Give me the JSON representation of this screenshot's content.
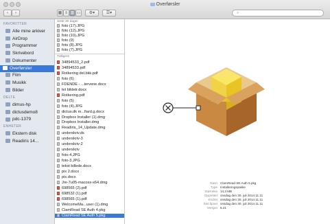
{
  "window": {
    "title": "Overførsler"
  },
  "toolbar": {
    "back": "‹",
    "forward": "›",
    "search_placeholder": ""
  },
  "sidebar": {
    "favorites_header": "FAVORITTER",
    "favorites": [
      {
        "label": "Alle mine arkiver",
        "icon": "all-files-icon"
      },
      {
        "label": "AirDrop",
        "icon": "airdrop-icon"
      },
      {
        "label": "Programmer",
        "icon": "applications-icon"
      },
      {
        "label": "Skrivebord",
        "icon": "desktop-icon"
      },
      {
        "label": "Dokumenter",
        "icon": "documents-icon"
      },
      {
        "label": "Overførsler",
        "icon": "downloads-icon"
      },
      {
        "label": "Film",
        "icon": "movies-icon"
      },
      {
        "label": "Musikk",
        "icon": "music-icon"
      },
      {
        "label": "Bilder",
        "icon": "pictures-icon"
      }
    ],
    "shared_header": "DELTE",
    "shared": [
      {
        "label": "dimus-hp",
        "icon": "network-pc-icon"
      },
      {
        "label": "dictusdemo8",
        "icon": "network-pc-icon"
      },
      {
        "label": "pdc-1379",
        "icon": "network-pc-icon"
      }
    ],
    "devices_header": "ENHETER",
    "devices": [
      {
        "label": "Ekstern disk",
        "icon": "disk-icon"
      },
      {
        "label": "Readiris 14...",
        "icon": "disk-icon"
      }
    ]
  },
  "files": {
    "last30_header": "Siste 30 dager",
    "last30": [
      "foto (17).JPG",
      "foto (12).JPG",
      "foto (10).JPG",
      "foto (9)",
      "foto (8).JPG",
      "foto (7).JPG"
    ],
    "earlier_header": "Tidligere",
    "earlier": [
      {
        "name": "34894533_2.pdf",
        "type": "pdf"
      },
      {
        "name": "34894533.pdf",
        "type": "pdf"
      },
      {
        "name": "Rotkering del.bkk.pdf",
        "type": "pdf"
      },
      {
        "name": "foto (6)",
        "type": "img"
      },
      {
        "name": "FDENDE - ...tervene.docx",
        "type": "doc"
      },
      {
        "name": "tet bildetr.docx",
        "type": "doc"
      },
      {
        "name": "Rotkering.pdf",
        "type": "pdf"
      },
      {
        "name": "foto (5)",
        "type": "img"
      },
      {
        "name": "foto (4).JPG",
        "type": "img"
      },
      {
        "name": "dictus.dk m...fiard.g.docx",
        "type": "doc"
      },
      {
        "name": "Dropbox Installer (1).dmg",
        "type": "dmg"
      },
      {
        "name": "Dropbox Installer.dmg",
        "type": "dmg"
      },
      {
        "name": "Readiris_14_Update.dmg",
        "type": "dmg"
      },
      {
        "name": "underskriv.ds",
        "type": "doc"
      },
      {
        "name": "underskriv-3",
        "type": "doc"
      },
      {
        "name": "underskriv-2",
        "type": "doc"
      },
      {
        "name": "underskriv",
        "type": "doc"
      },
      {
        "name": "foto-4.JPG",
        "type": "img"
      },
      {
        "name": "foto-3.JPG",
        "type": "img"
      },
      {
        "name": "tekst billede.docx",
        "type": "doc"
      },
      {
        "name": "pix 2.docx",
        "type": "doc"
      },
      {
        "name": "pix.docx",
        "type": "doc"
      },
      {
        "name": "Jre-7u05-macosx-x64.dmg",
        "type": "dmg"
      },
      {
        "name": "698565 (2).pdf",
        "type": "pdf"
      },
      {
        "name": "698532 (1).pdf",
        "type": "pdf"
      },
      {
        "name": "698565 (1).pdf",
        "type": "pdf"
      },
      {
        "name": "WelcomeMa...user (1).dmg",
        "type": "dmg"
      },
      {
        "name": "CiamRead SE Auth 4.pkg",
        "type": "pkg"
      },
      {
        "name": "CiamRead SE Auth 5.pkg",
        "type": "pkg"
      }
    ],
    "selected_index": 28
  },
  "preview": {
    "icon": "package-installer-icon",
    "marker_icon": "circle-x-icon",
    "info": [
      {
        "label": "Navn",
        "value": "ClaroRead SE Auth 5.pkg"
      },
      {
        "label": "Type",
        "value": "Installeringspakke"
      },
      {
        "label": "Størrelse",
        "value": "14,3 MB"
      },
      {
        "label": "Opprettet",
        "value": "onsdag den 30. juli 2014 11.11"
      },
      {
        "label": "Endret",
        "value": "onsdag den 30. juli 2014 11.11"
      },
      {
        "label": "Sist åpnet",
        "value": "onsdag den 30. juli 2014 11.11"
      },
      {
        "label": "Versjon",
        "value": "5.21"
      }
    ]
  }
}
